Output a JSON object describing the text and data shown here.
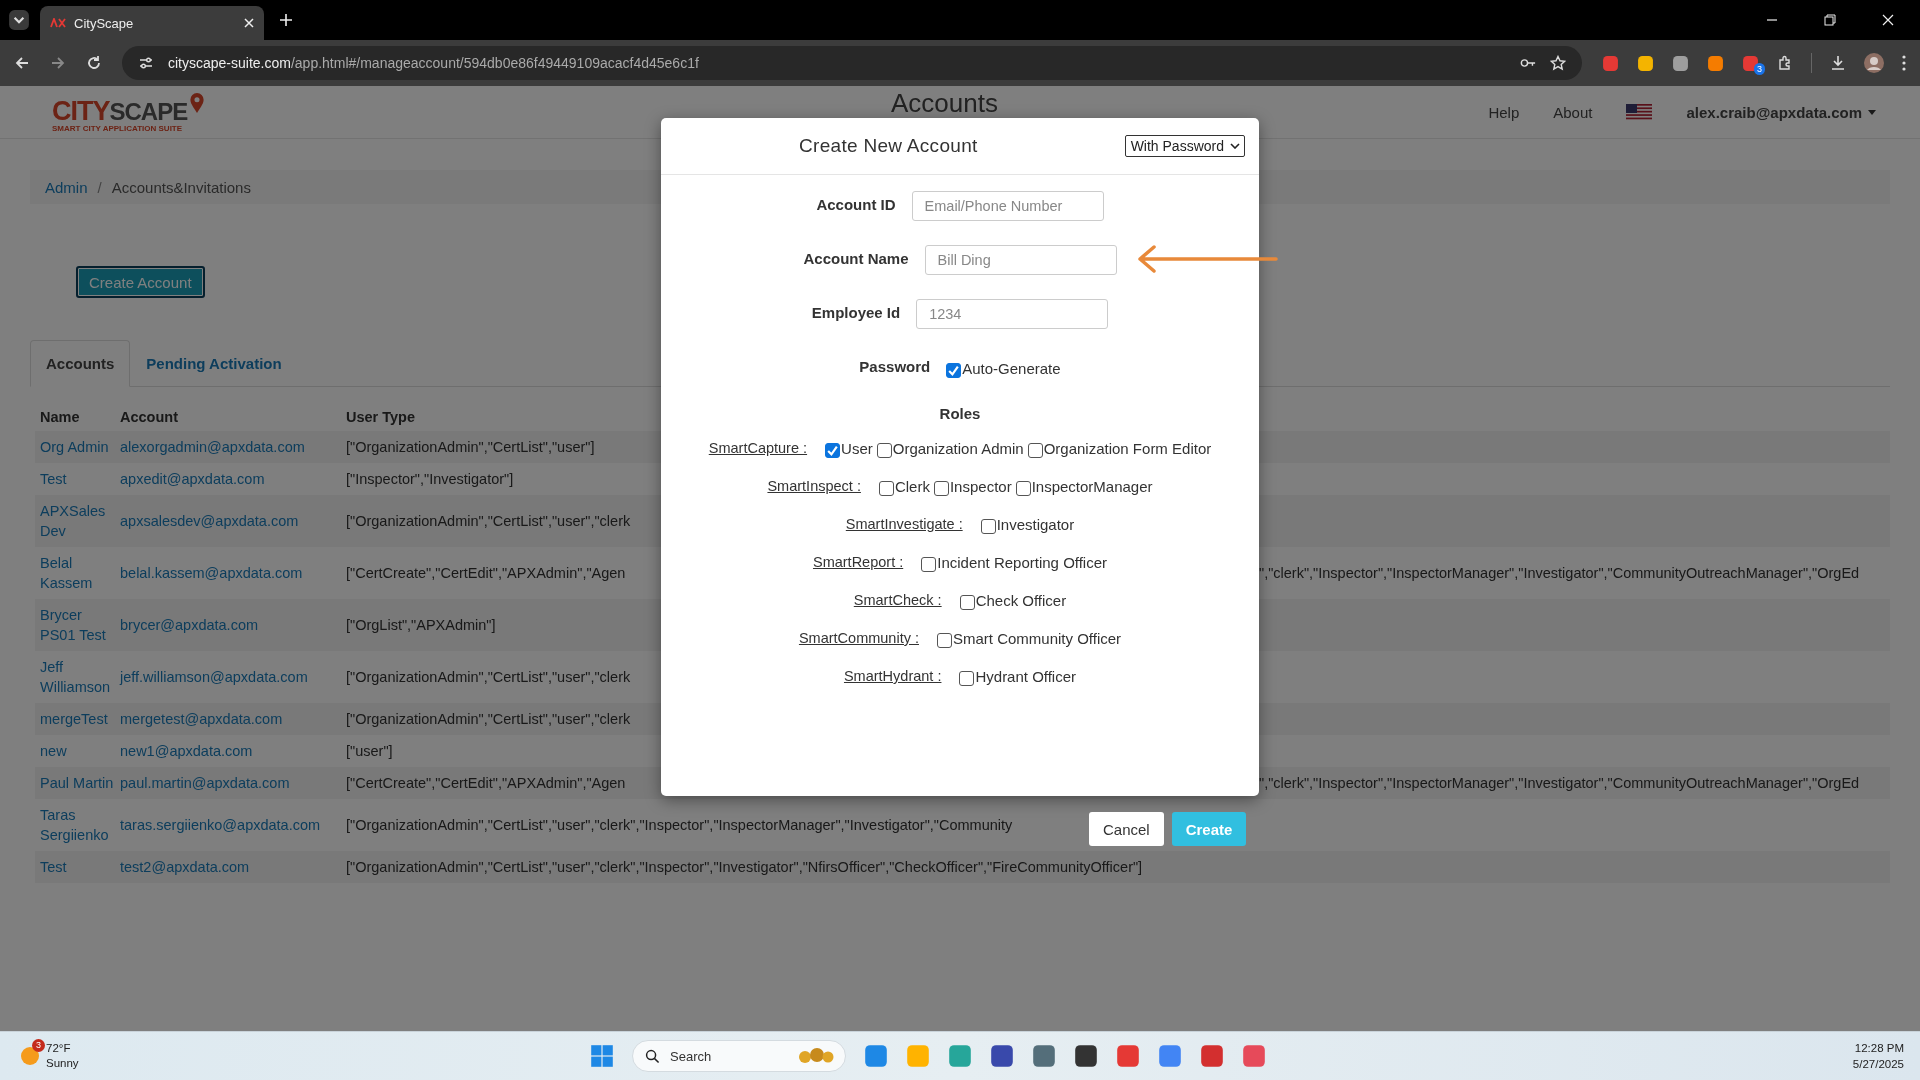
{
  "browser": {
    "tab_title": "CityScape",
    "url_host": "cityscape-suite.com",
    "url_path": "/app.html#/manageaccount/594db0e86f49449109acacf4d45e6c1f",
    "extension_badge": "3"
  },
  "header": {
    "logo_main": "CITY",
    "logo_rest": "SCAPE",
    "logo_tagline": "SMART CITY APPLICATION SUITE",
    "page_title": "Accounts",
    "nav": [
      "Help",
      "About"
    ],
    "user": "alex.craib@apxdata.com"
  },
  "breadcrumb": [
    "Admin",
    "Accounts&Invitations"
  ],
  "breadcrumb_separator": "/",
  "create_button": "Create Account",
  "tabs": [
    {
      "label": "Accounts",
      "selected": true
    },
    {
      "label": "Pending Activation",
      "selected": false
    }
  ],
  "table": {
    "columns": [
      "Name",
      "Account",
      "User Type"
    ],
    "rows": [
      {
        "name": "Org Admin",
        "account": "alexorgadmin@apxdata.com",
        "user_type": "[\"OrganizationAdmin\",\"CertList\",\"user\"]"
      },
      {
        "name": "Test",
        "account": "apxedit@apxdata.com",
        "user_type": "[\"Inspector\",\"Investigator\"]"
      },
      {
        "name": "APXSales Dev",
        "account": "apxsalesdev@apxdata.com",
        "user_type": "[\"OrganizationAdmin\",\"CertList\",\"user\",\"clerk"
      },
      {
        "name": "Belal Kassem",
        "account": "belal.kassem@apxdata.com",
        "user_type": "[\"CertCreate\",\"CertEdit\",\"APXAdmin\",\"Agen",
        "user_type_right": "\",\"clerk\",\"Inspector\",\"InspectorManager\",\"Investigator\",\"CommunityOutreachManager\",\"OrgEd"
      },
      {
        "name": "Brycer PS01 Test",
        "account": "brycer@apxdata.com",
        "user_type": "[\"OrgList\",\"APXAdmin\"]"
      },
      {
        "name": "Jeff Williamson",
        "account": "jeff.williamson@apxdata.com",
        "user_type": "[\"OrganizationAdmin\",\"CertList\",\"user\",\"clerk"
      },
      {
        "name": "mergeTest",
        "account": "mergetest@apxdata.com",
        "user_type": "[\"OrganizationAdmin\",\"CertList\",\"user\",\"clerk"
      },
      {
        "name": "new",
        "account": "new1@apxdata.com",
        "user_type": "[\"user\"]"
      },
      {
        "name": "Paul Martin",
        "account": "paul.martin@apxdata.com",
        "user_type": "[\"CertCreate\",\"CertEdit\",\"APXAdmin\",\"Agen",
        "user_type_right": "\",\"clerk\",\"Inspector\",\"InspectorManager\",\"Investigator\",\"CommunityOutreachManager\",\"OrgEd"
      },
      {
        "name": "Taras Sergiienko",
        "account": "taras.sergiienko@apxdata.com",
        "user_type": "[\"OrganizationAdmin\",\"CertList\",\"user\",\"clerk\",\"Inspector\",\"InspectorManager\",\"Investigator\",\"Community"
      },
      {
        "name": "Test",
        "account": "test2@apxdata.com",
        "user_type": "[\"OrganizationAdmin\",\"CertList\",\"user\",\"clerk\",\"Inspector\",\"Investigator\",\"NfirsOfficer\",\"CheckOfficer\",\"FireCommunityOfficer\"]"
      }
    ]
  },
  "modal": {
    "title": "Create New Account",
    "mode": "With Password",
    "fields": [
      {
        "label": "Account ID",
        "placeholder": "Email/Phone Number"
      },
      {
        "label": "Account Name",
        "placeholder": "Bill Ding"
      },
      {
        "label": "Employee Id",
        "placeholder": "1234"
      }
    ],
    "password": {
      "label": "Password",
      "option": "Auto-Generate",
      "checked": true
    },
    "roles_heading": "Roles",
    "roles": [
      {
        "app": "SmartCapture :",
        "options": [
          {
            "label": "User",
            "checked": true
          },
          {
            "label": "Organization Admin",
            "checked": false
          },
          {
            "label": "Organization Form Editor",
            "checked": false
          }
        ]
      },
      {
        "app": "SmartInspect :",
        "options": [
          {
            "label": "Clerk",
            "checked": false
          },
          {
            "label": "Inspector",
            "checked": false
          },
          {
            "label": "InspectorManager",
            "checked": false
          }
        ]
      },
      {
        "app": "SmartInvestigate :",
        "options": [
          {
            "label": "Investigator",
            "checked": false
          }
        ]
      },
      {
        "app": "SmartReport :",
        "options": [
          {
            "label": "Incident Reporting Officer",
            "checked": false
          }
        ]
      },
      {
        "app": "SmartCheck :",
        "options": [
          {
            "label": "Check Officer",
            "checked": false
          }
        ]
      },
      {
        "app": "SmartCommunity :",
        "options": [
          {
            "label": "Smart Community Officer",
            "checked": false
          }
        ]
      },
      {
        "app": "SmartHydrant :",
        "options": [
          {
            "label": "Hydrant Officer",
            "checked": false
          }
        ]
      }
    ],
    "buttons": [
      "Cancel",
      "Create"
    ]
  },
  "taskbar": {
    "weather_badge": "3",
    "temperature": "72°F",
    "weather": "Sunny",
    "search_placeholder": "Search",
    "time": "12:28 PM",
    "date": "5/27/2025"
  }
}
